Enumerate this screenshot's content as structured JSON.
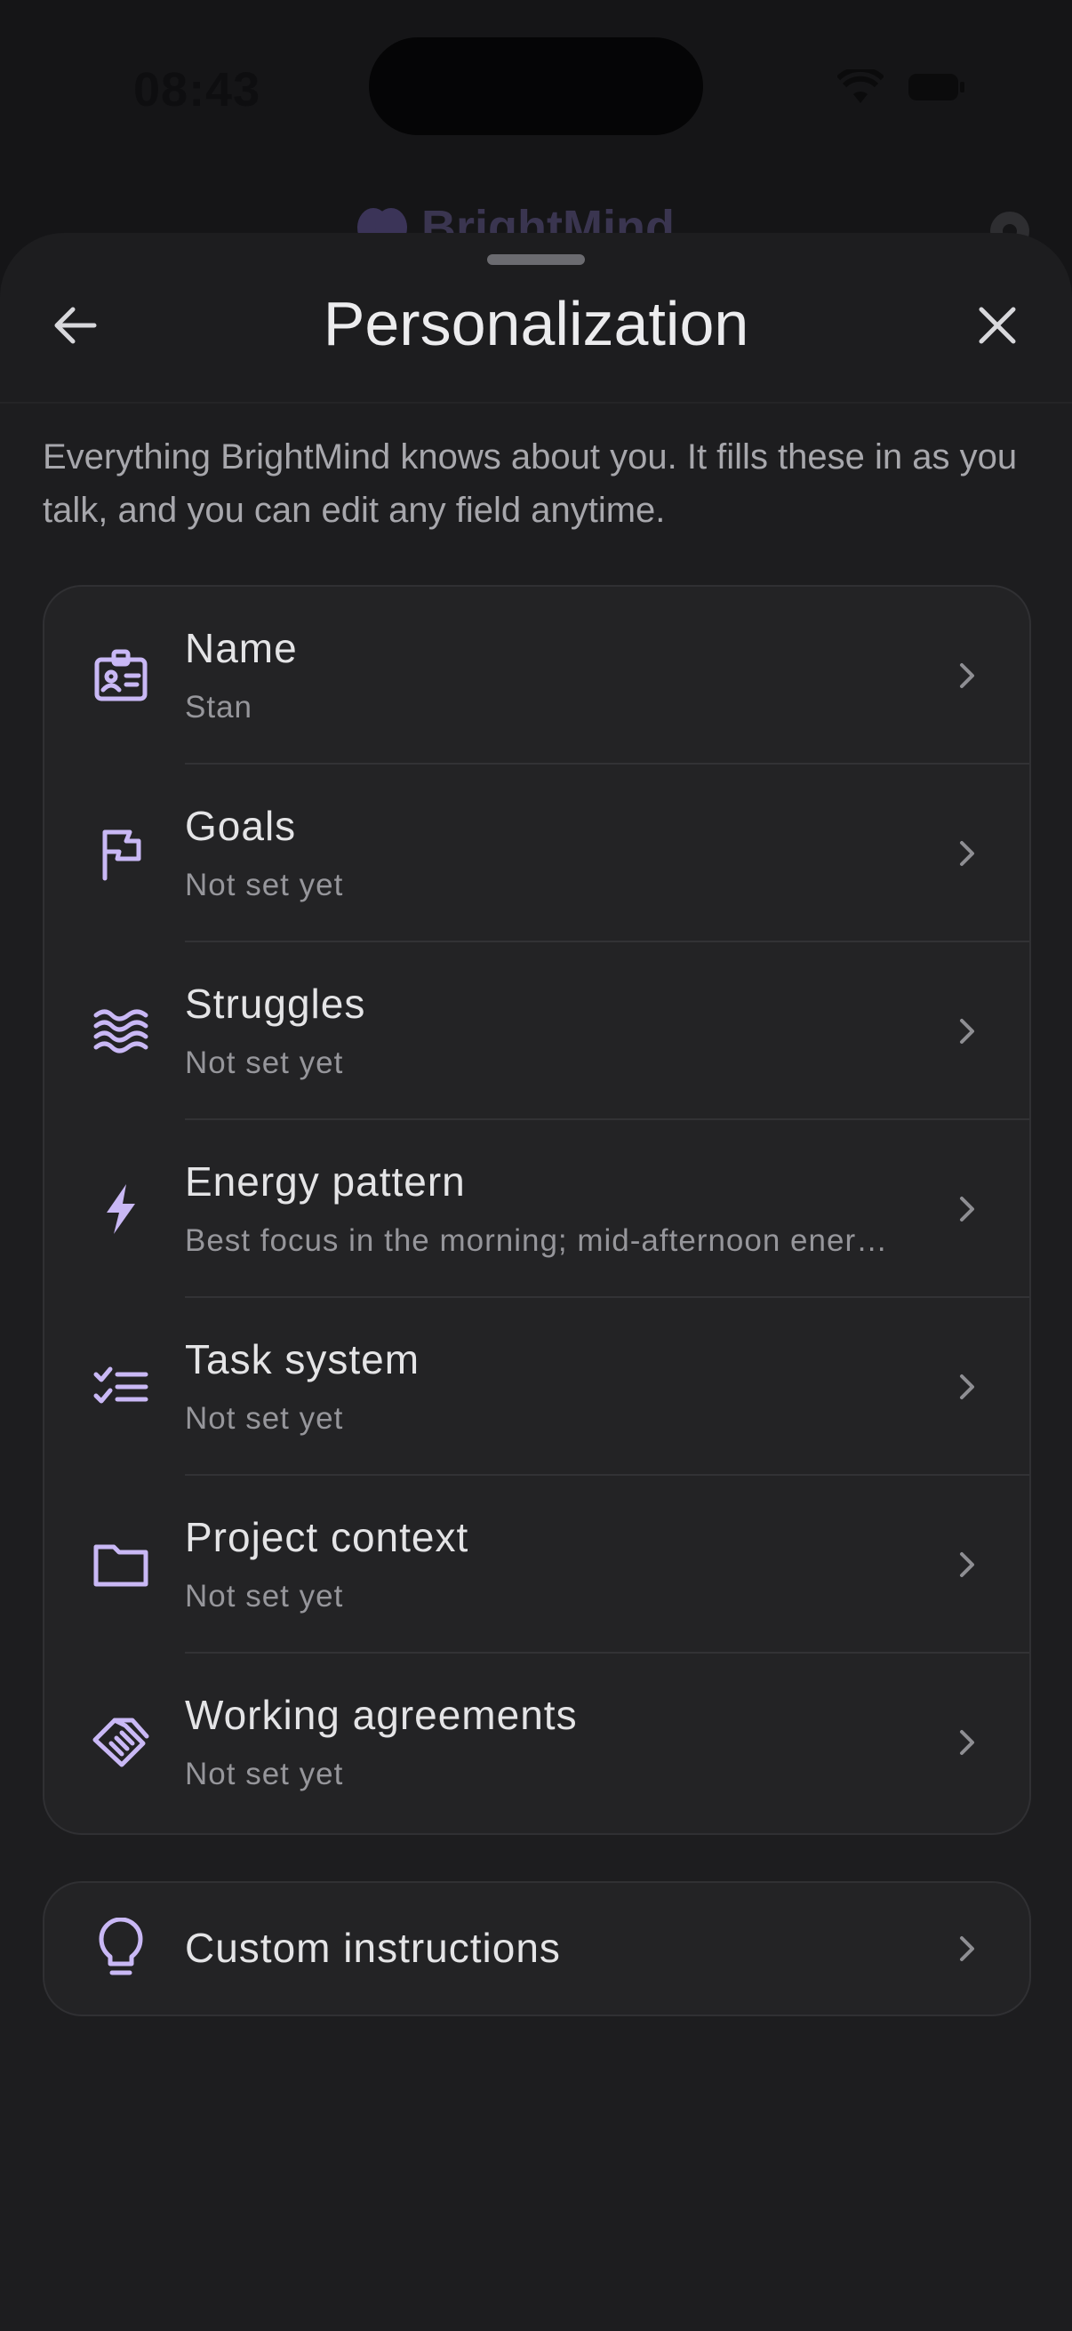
{
  "status_bar": {
    "time": "08:43",
    "wifi_icon": "wifi-icon",
    "battery_icon": "battery-icon"
  },
  "background_app": {
    "title": "BrightMind",
    "logo_icon": "brain-icon",
    "settings_icon": "gear-icon"
  },
  "sheet": {
    "title": "Personalization",
    "back_icon": "arrow-left-icon",
    "close_icon": "close-icon",
    "description": "Everything BrightMind knows about you. It fills these in as you talk, and you can edit any field anytime.",
    "fields": [
      {
        "title": "Name",
        "value": "Stan",
        "icon": "id-badge-icon"
      },
      {
        "title": "Goals",
        "value": "Not set yet",
        "icon": "flag-icon"
      },
      {
        "title": "Struggles",
        "value": "Not set yet",
        "icon": "waves-icon"
      },
      {
        "title": "Energy pattern",
        "value": "Best focus in the morning; mid-afternoon ener…",
        "icon": "lightning-icon"
      },
      {
        "title": "Task system",
        "value": "Not set yet",
        "icon": "checklist-icon"
      },
      {
        "title": "Project context",
        "value": "Not set yet",
        "icon": "folder-icon"
      },
      {
        "title": "Working agreements",
        "value": "Not set yet",
        "icon": "handshake-icon"
      }
    ],
    "custom_instructions": {
      "title": "Custom instructions",
      "icon": "lightbulb-icon"
    }
  },
  "colors": {
    "accent": "#c9b8f5",
    "background": "#151517",
    "sheet": "#1d1d1f",
    "card": "#232325"
  }
}
